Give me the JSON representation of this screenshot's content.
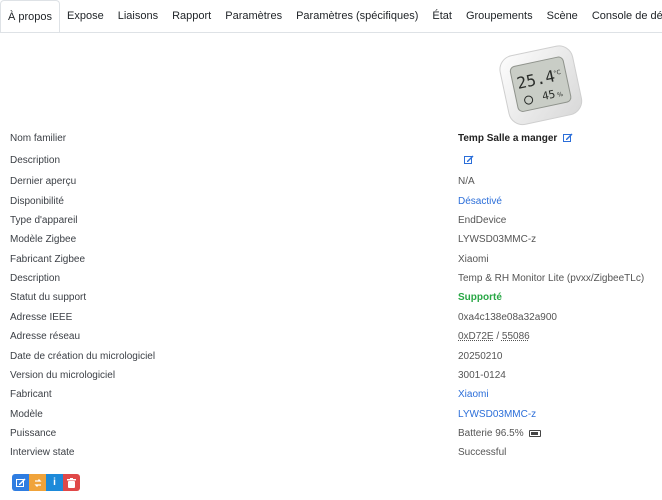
{
  "tabs": [
    {
      "label": "À propos",
      "active": true
    },
    {
      "label": "Expose"
    },
    {
      "label": "Liaisons"
    },
    {
      "label": "Rapport"
    },
    {
      "label": "Paramètres"
    },
    {
      "label": "Paramètres (spécifiques)"
    },
    {
      "label": "État"
    },
    {
      "label": "Groupements"
    },
    {
      "label": "Scène"
    },
    {
      "label": "Console de développement"
    }
  ],
  "device_display": {
    "temp": "25.4",
    "unit": "°C",
    "humidity": "45",
    "humidity_unit": "%"
  },
  "details": {
    "friendly_name": {
      "label": "Nom familier",
      "value": "Temp Salle a manger"
    },
    "description_editable": {
      "label": "Description",
      "value": ""
    },
    "last_seen": {
      "label": "Dernier aperçu",
      "value": "N/A"
    },
    "availability": {
      "label": "Disponibilité",
      "value": "Désactivé"
    },
    "device_type": {
      "label": "Type d'appareil",
      "value": "EndDevice"
    },
    "zigbee_model": {
      "label": "Modèle Zigbee",
      "value": "LYWSD03MMC-z"
    },
    "zigbee_manufacturer": {
      "label": "Fabricant Zigbee",
      "value": "Xiaomi"
    },
    "description": {
      "label": "Description",
      "value": "Temp & RH Monitor Lite (pvxx/ZigbeeTLc)"
    },
    "support_status": {
      "label": "Statut du support",
      "value": "Supporté"
    },
    "ieee_address": {
      "label": "Adresse IEEE",
      "value": "0xa4c138e08a32a900"
    },
    "network_address": {
      "label": "Adresse réseau",
      "value_hex": "0xD72E",
      "separator": " / ",
      "value_dec": "55086"
    },
    "firmware_date": {
      "label": "Date de création du micrologiciel",
      "value": "20250210"
    },
    "firmware_version": {
      "label": "Version du micrologiciel",
      "value": "3001-0124"
    },
    "manufacturer": {
      "label": "Fabricant",
      "value": "Xiaomi"
    },
    "model": {
      "label": "Modèle",
      "value": "LYWSD03MMC-z"
    },
    "power": {
      "label": "Puissance",
      "value": "Batterie 96.5%"
    },
    "interview_state": {
      "label": "Interview state",
      "value": "Successful"
    }
  },
  "colors": {
    "accent": "#2b6ed9",
    "success": "#28a745",
    "warning": "#f0a33a",
    "danger": "#e04848"
  }
}
